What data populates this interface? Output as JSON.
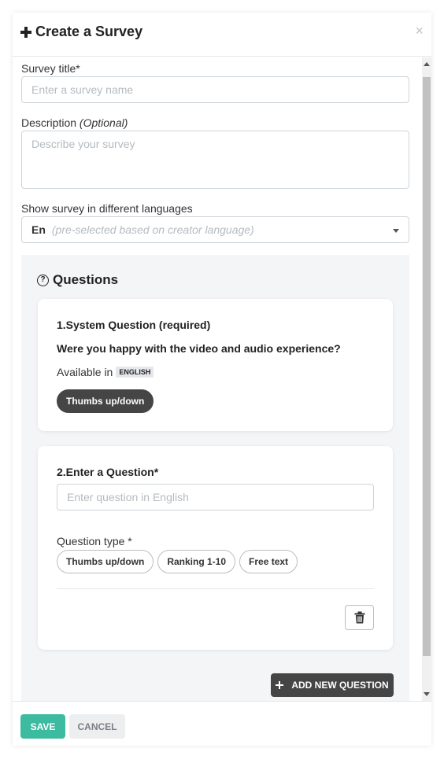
{
  "modal": {
    "title": "Create a Survey",
    "title_icon": "plus-icon",
    "close_icon": "×"
  },
  "form": {
    "survey_title": {
      "label": "Survey title*",
      "value": "",
      "placeholder": "Enter a survey name"
    },
    "description": {
      "label": "Description",
      "label_suffix": "(Optional)",
      "value": "",
      "placeholder": "Describe your survey"
    },
    "languages": {
      "label": "Show survey in different languages",
      "selected": "En",
      "hint": "(pre-selected based on creator language)"
    }
  },
  "questions": {
    "heading": "Questions",
    "heading_icon": "?",
    "items": [
      {
        "title": "1.System Question (required)",
        "text": "Were you happy with the video and audio experience?",
        "available_label": "Available in",
        "language_badge": "ENGLISH",
        "type_selected": "Thumbs up/down"
      },
      {
        "title": "2.Enter a Question*",
        "input_value": "",
        "input_placeholder": "Enter question in English",
        "type_label": "Question type *",
        "type_options": [
          "Thumbs up/down",
          "Ranking 1-10",
          "Free text"
        ]
      }
    ],
    "add_button_label": "ADD NEW QUESTION"
  },
  "footer": {
    "save_label": "SAVE",
    "cancel_label": "CANCEL"
  },
  "colors": {
    "save": "#3dbba0",
    "dark_chip": "#454545",
    "panel_bg": "#f4f5f7"
  }
}
